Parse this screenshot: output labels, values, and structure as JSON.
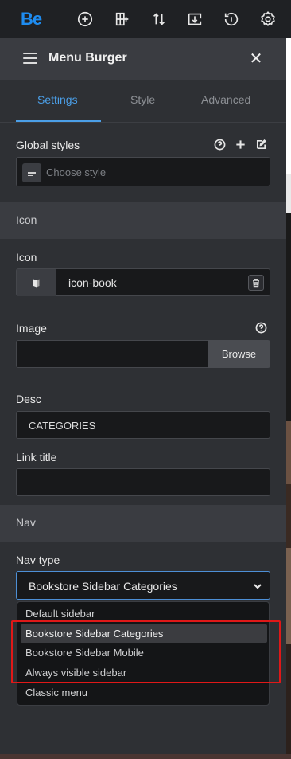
{
  "toolbar": {
    "logo": "Be",
    "icons": [
      "add-icon",
      "layout-add-icon",
      "sort-arrows-icon",
      "import-icon",
      "history-icon",
      "settings-gear-icon"
    ]
  },
  "header": {
    "title": "Menu Burger",
    "menu_icon": "hamburger-icon",
    "close_icon": "close-icon"
  },
  "tabs": [
    {
      "label": "Settings",
      "active": true
    },
    {
      "label": "Style",
      "active": false
    },
    {
      "label": "Advanced",
      "active": false
    }
  ],
  "global_styles": {
    "label": "Global styles",
    "placeholder": "Choose style"
  },
  "sections": {
    "icon": "Icon",
    "nav": "Nav"
  },
  "icon_field": {
    "label": "Icon",
    "value": "icon-book"
  },
  "image_field": {
    "label": "Image",
    "button": "Browse"
  },
  "desc_field": {
    "label": "Desc",
    "value": "CATEGORIES"
  },
  "link_title_field": {
    "label": "Link title",
    "value": ""
  },
  "nav_type": {
    "label": "Nav type",
    "selected": "Bookstore Sidebar Categories",
    "options": [
      "Default sidebar",
      "Bookstore Sidebar Categories",
      "Bookstore Sidebar Mobile",
      "Always visible sidebar",
      "Classic menu"
    ],
    "highlighted_index": 1
  },
  "colors": {
    "accent": "#4b9fe8",
    "highlight_box": "#e01818",
    "logo": "#1e8cf0"
  }
}
